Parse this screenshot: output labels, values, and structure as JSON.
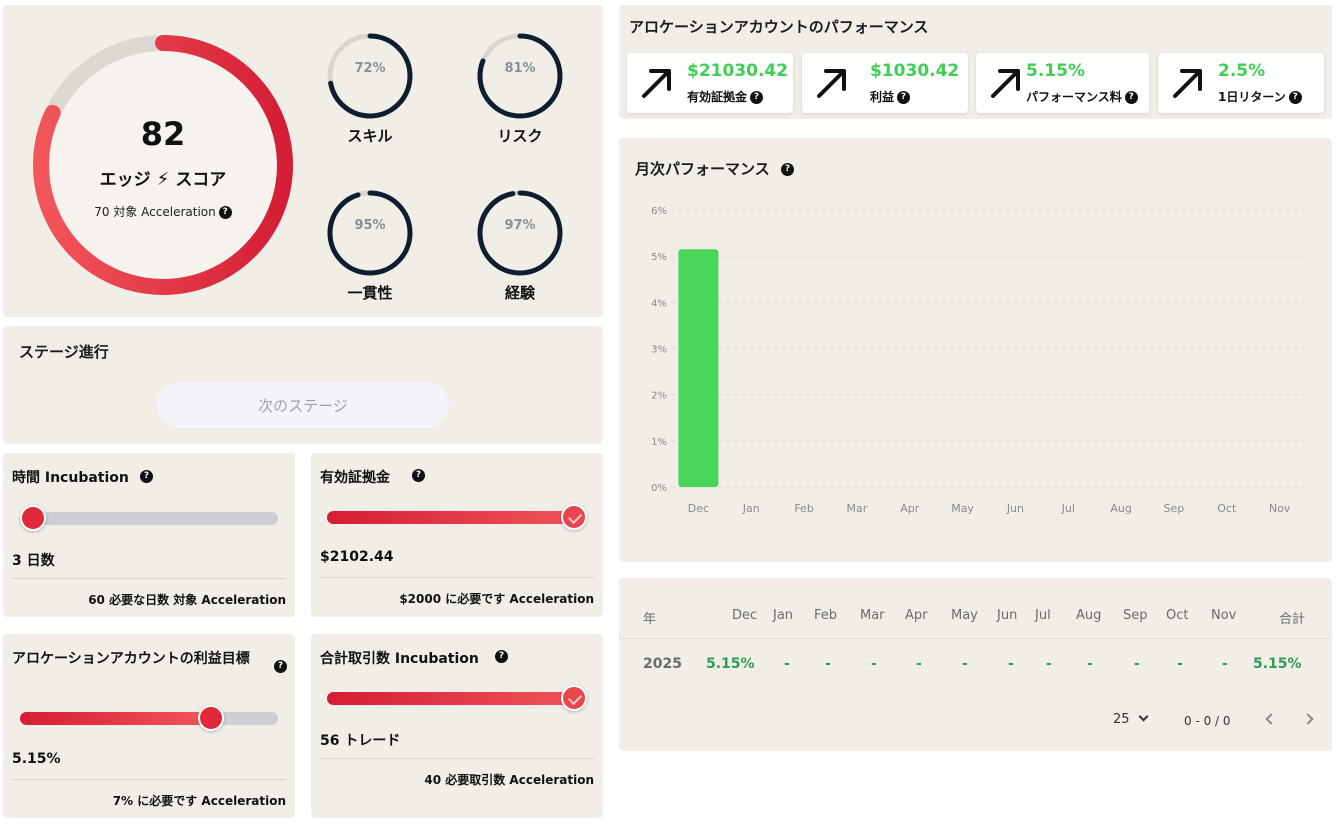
{
  "score": {
    "value": "82",
    "label_left": "エッジ",
    "label_right": "スコア",
    "sub": "70 対象 Acceleration",
    "fraction": 0.82,
    "colors": {
      "start": "#f2565a",
      "end": "#d41d36",
      "track": "#dcd8d2"
    }
  },
  "mini_gauges": [
    {
      "pct": "72%",
      "label": "スキル",
      "fraction": 0.72
    },
    {
      "pct": "81%",
      "label": "リスク",
      "fraction": 0.81
    },
    {
      "pct": "95%",
      "label": "一貫性",
      "fraction": 0.95
    },
    {
      "pct": "97%",
      "label": "経験",
      "fraction": 0.97
    }
  ],
  "stage": {
    "title": "ステージ進行",
    "button": "次のステージ"
  },
  "metrics": [
    {
      "title": "時間 Incubation",
      "value": "3 日数",
      "footer": "60 必要な日数 対象 Acceleration",
      "progress": 0.05
    },
    {
      "title": "有効証拠金",
      "value": "$2102.44",
      "footer": "$2000 に必要です Acceleration",
      "progress": 1.0
    },
    {
      "title": "アロケーションアカウントの利益目標",
      "value": "5.15%",
      "footer": "7% に必要です Acceleration",
      "progress": 0.74
    },
    {
      "title": "合計取引数 Incubation",
      "value": "56 トレード",
      "footer": "40 必要取引数 Acceleration",
      "progress": 1.0
    }
  ],
  "performance": {
    "title": "アロケーションアカウントのパフォーマンス",
    "kpis": [
      {
        "value": "$21030.42",
        "label": "有効証拠金"
      },
      {
        "value": "$1030.42",
        "label": "利益"
      },
      {
        "value": "5.15%",
        "label": "パフォーマンス料"
      },
      {
        "value": "2.5%",
        "label": "1日リターン"
      }
    ],
    "accent": "#3fcf55"
  },
  "chart_title": "月次パフォーマンス",
  "chart_data": {
    "type": "bar",
    "title": "月次パフォーマンス",
    "categories": [
      "Dec",
      "Jan",
      "Feb",
      "Mar",
      "Apr",
      "May",
      "Jun",
      "Jul",
      "Aug",
      "Sep",
      "Oct",
      "Nov"
    ],
    "values": [
      5.15,
      0,
      0,
      0,
      0,
      0,
      0,
      0,
      0,
      0,
      0,
      0
    ],
    "yticks": [
      "0%",
      "1%",
      "2%",
      "3%",
      "4%",
      "5%",
      "6%"
    ],
    "ylim": [
      0,
      6
    ],
    "grid": true,
    "bar_color": "#48d65b"
  },
  "table": {
    "headers": [
      "年",
      "Dec",
      "Jan",
      "Feb",
      "Mar",
      "Apr",
      "May",
      "Jun",
      "Jul",
      "Aug",
      "Sep",
      "Oct",
      "Nov",
      "合計"
    ],
    "row": [
      "2025",
      "5.15%",
      "-",
      "-",
      "-",
      "-",
      "-",
      "-",
      "-",
      "-",
      "-",
      "-",
      "-",
      "5.15%"
    ],
    "page_size": "25",
    "range": "0 - 0 / 0"
  }
}
